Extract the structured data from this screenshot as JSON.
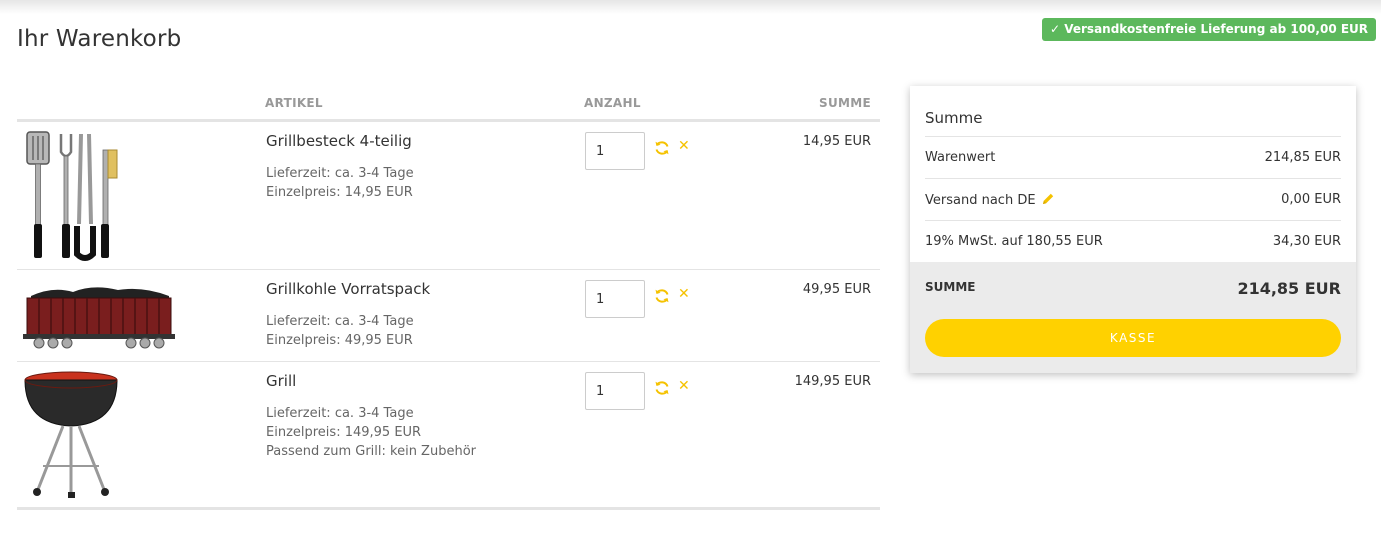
{
  "page": {
    "title": "Ihr Warenkorb",
    "shipping_badge": "✓ Versandkostenfreie Lieferung ab 100,00 EUR"
  },
  "cart": {
    "headers": {
      "artikel": "ARTIKEL",
      "anzahl": "ANZAHL",
      "summe": "SUMME"
    },
    "items": [
      {
        "name": "Grillbesteck 4-teilig",
        "lieferzeit": "Lieferzeit: ca. 3-4 Tage",
        "einzelpreis": "Einzelpreis: 14,95 EUR",
        "extra": "",
        "quantity": "1",
        "sum": "14,95 EUR",
        "image": "grill-utensils-image"
      },
      {
        "name": "Grillkohle Vorratspack",
        "lieferzeit": "Lieferzeit: ca. 3-4 Tage",
        "einzelpreis": "Einzelpreis: 49,95 EUR",
        "extra": "",
        "quantity": "1",
        "sum": "49,95 EUR",
        "image": "coal-wagon-image"
      },
      {
        "name": "Grill",
        "lieferzeit": "Lieferzeit: ca. 3-4 Tage",
        "einzelpreis": "Einzelpreis: 149,95 EUR",
        "extra": "Passend zum Grill: kein Zubehör",
        "quantity": "1",
        "sum": "149,95 EUR",
        "image": "kettle-grill-image"
      }
    ],
    "icons": {
      "refresh": "refresh-icon",
      "remove": "close-icon"
    }
  },
  "summary": {
    "title": "Summe",
    "warenwert_label": "Warenwert",
    "warenwert_value": "214,85 EUR",
    "versand_label": "Versand nach DE",
    "versand_value": "0,00 EUR",
    "mwst_label": "19% MwSt. auf 180,55 EUR",
    "mwst_value": "34,30 EUR",
    "total_label": "SUMME",
    "total_value": "214,85 EUR",
    "checkout_label": "KASSE"
  },
  "colors": {
    "accent": "#ffd100",
    "badge": "#5cb85c",
    "icon_yellow": "#f5c200"
  }
}
